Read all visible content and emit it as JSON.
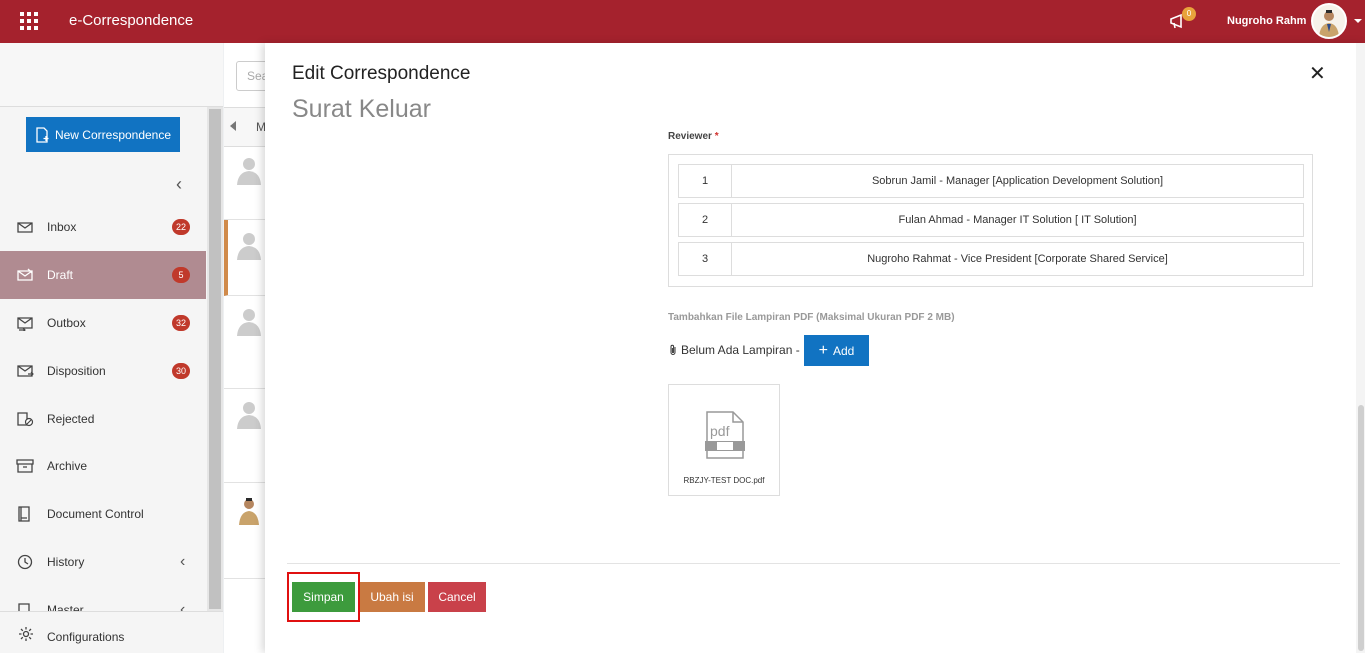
{
  "topbar": {
    "app_title": "e-Correspondence",
    "notification_count": "0",
    "user_name": "Nugroho Rahm"
  },
  "sidebar": {
    "new_button": "New Correspondence",
    "items": [
      {
        "label": "Inbox",
        "badge": "22"
      },
      {
        "label": "Draft",
        "badge": "5"
      },
      {
        "label": "Outbox",
        "badge": "32"
      },
      {
        "label": "Disposition",
        "badge": "30"
      },
      {
        "label": "Rejected"
      },
      {
        "label": "Archive"
      },
      {
        "label": "Document Control"
      },
      {
        "label": "History"
      },
      {
        "label": "Master"
      }
    ],
    "bottom": "Configurations"
  },
  "midlist": {
    "search_placeholder": "Sea",
    "col_head": "M"
  },
  "modal": {
    "title": "Edit Correspondence",
    "subtitle": "Surat Keluar",
    "reviewer_label": "Reviewer",
    "required_mark": "*",
    "reviewers": [
      {
        "no": "1",
        "name": "Sobrun Jamil - Manager [Application Development Solution]"
      },
      {
        "no": "2",
        "name": "Fulan Ahmad - Manager IT Solution [ IT Solution]"
      },
      {
        "no": "3",
        "name": "Nugroho Rahmat - Vice President [Corporate Shared Service]"
      }
    ],
    "attach_label": "Tambahkan File Lampiran PDF (Maksimal Ukuran PDF 2 MB)",
    "attach_status": "Belum Ada Lampiran -",
    "add_label": "Add",
    "file_icon_text": "pdf",
    "file_name": "RBZJY-TEST DOC.pdf",
    "buttons": {
      "save": "Simpan",
      "edit": "Ubah isi",
      "cancel": "Cancel"
    }
  },
  "colors": {
    "brand": "#a5222d",
    "primary": "#1173c2",
    "save": "#3d9b3d",
    "edit": "#c97a42",
    "cancel": "#c9414a",
    "badge": "#c0392b",
    "highlight": "#e01010"
  }
}
